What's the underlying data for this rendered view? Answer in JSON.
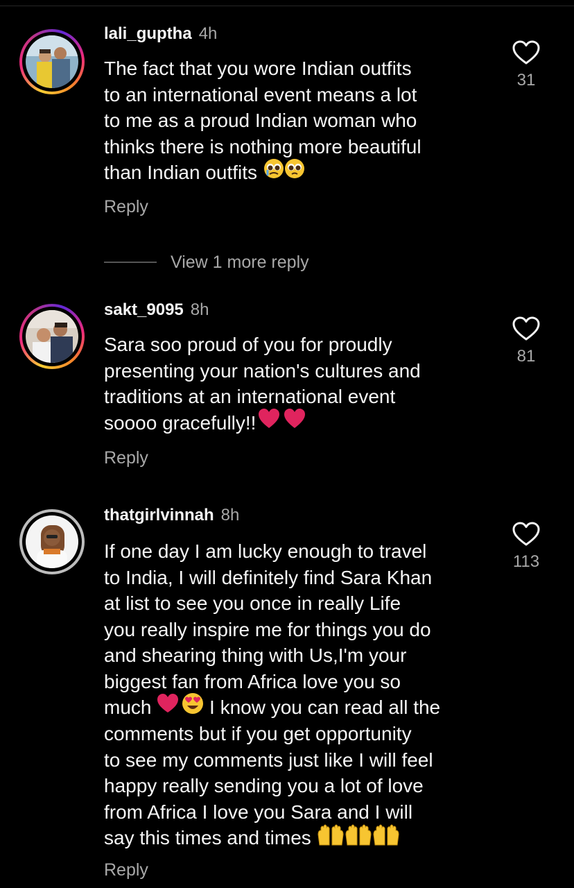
{
  "comments": [
    {
      "username": "lali_guptha",
      "time": "4h",
      "text": "The fact that you wore Indian outfits\nto an international event means a lot\nto me as a proud Indian woman who\nthinks there is nothing more beautiful\nthan Indian outfits",
      "likes": "31",
      "reply": "Reply"
    },
    {
      "username": "sakt_9095",
      "time": "8h",
      "text": "Sara soo proud of you for proudly\npresenting your nation's cultures and\ntraditions at an international event\nsoooo gracefully!!",
      "likes": "81",
      "reply": "Reply"
    },
    {
      "username": "thatgirlvinnah",
      "time": "8h",
      "text_part1": "If one day I am lucky enough to travel\nto India, I will definitely find Sara Khan\nat list to see you  once in really Life\nyou really inspire me for things you do\nand shearing thing with Us,I'm your\nbiggest fan from Africa love you so\nmuch ",
      "text_part2": " I know you can read all the\ncomments but if you get opportunity\nto see my comments just like I will feel\nhappy really sending you a lot of love\nfrom Africa I love you Sara and I will\nsay this times and times ",
      "likes": "113",
      "reply": "Reply"
    }
  ],
  "view_more_replies": "View 1 more reply",
  "colors": {
    "background": "#000000",
    "text": "#f5f5f5",
    "secondary": "#a8a8a8",
    "heart_red": "#e0245e"
  }
}
